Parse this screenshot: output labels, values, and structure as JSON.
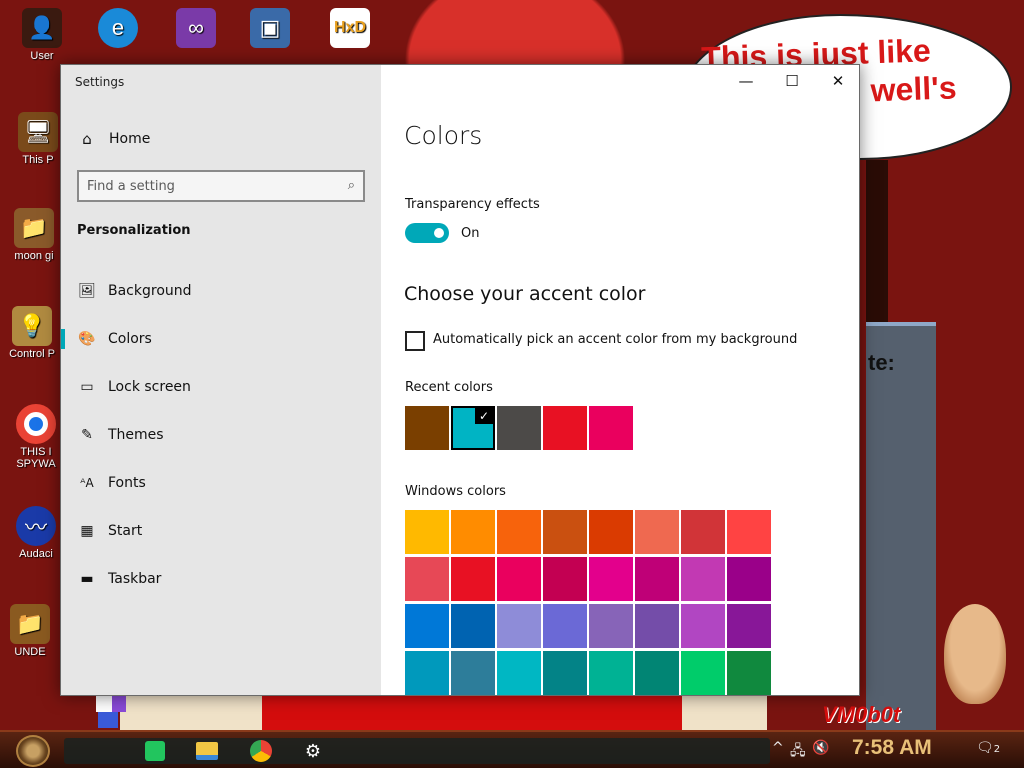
{
  "desktop": {
    "icons": [
      {
        "label": "User",
        "icon": "user-folder-icon",
        "color": "#5a1a0a"
      },
      {
        "label": "This P",
        "icon": "this-pc-icon",
        "color": "#7a4a1a"
      },
      {
        "label": "moon gi",
        "icon": "moon-folder-icon",
        "color": "#8a5a2a"
      },
      {
        "label": "Control P",
        "icon": "lightbulb-icon",
        "color": "#b08a40"
      },
      {
        "label": "THIS I",
        "icon": "chrome-icon",
        "color": "#1a73e8"
      },
      {
        "label": "SPYWA",
        "icon": "",
        "color": ""
      },
      {
        "label": "Audaci",
        "icon": "audacity-icon",
        "color": "#f08a1a"
      },
      {
        "label": "UNDE",
        "icon": "folder-icon",
        "color": "#8a5a20"
      }
    ],
    "top_icons": [
      {
        "label": "",
        "icon": "edge-icon",
        "color": "#1a8ad8"
      },
      {
        "label": "",
        "icon": "visual-studio-icon",
        "color": "#7a3aa8"
      },
      {
        "label": "",
        "icon": "virtualbox-icon",
        "color": "#3a6aa8"
      },
      {
        "label": "",
        "icon": "hxd-icon",
        "color": "#e8a020"
      }
    ],
    "speech_line1": "This is just like",
    "speech_line2": "well's",
    "gray_panel_text": "te:",
    "vm_text": "VM0b0t"
  },
  "window": {
    "title": "Settings",
    "controls": {
      "minimize": "—",
      "maximize": "☐",
      "close": "✕"
    }
  },
  "sidebar": {
    "home_label": "Home",
    "search_placeholder": "Find a setting",
    "section": "Personalization",
    "items": [
      {
        "label": "Background",
        "icon": "image-icon",
        "glyph": "🖼"
      },
      {
        "label": "Colors",
        "icon": "palette-icon",
        "glyph": "🎨",
        "active": true
      },
      {
        "label": "Lock screen",
        "icon": "lock-screen-icon",
        "glyph": "🖵"
      },
      {
        "label": "Themes",
        "icon": "brush-icon",
        "glyph": "✎"
      },
      {
        "label": "Fonts",
        "icon": "fonts-icon",
        "glyph": "A"
      },
      {
        "label": "Start",
        "icon": "start-tiles-icon",
        "glyph": "▦"
      },
      {
        "label": "Taskbar",
        "icon": "taskbar-icon",
        "glyph": "▭"
      }
    ]
  },
  "content": {
    "title": "Colors",
    "transparency_label": "Transparency effects",
    "transparency_state": "On",
    "accent_title": "Choose your accent color",
    "auto_pick_label": "Automatically pick an accent color from my background",
    "recent_label": "Recent colors",
    "recent_colors": [
      "#7a3f00",
      "#00b4c4",
      "#4c4a48",
      "#e81123",
      "#ea005e"
    ],
    "selected_recent": 1,
    "windows_label": "Windows colors",
    "windows_colors": [
      [
        "#ffb900",
        "#ff8c00",
        "#f7630c",
        "#ca5010",
        "#da3b01",
        "#ef6950",
        "#d13438",
        "#ff4343"
      ],
      [
        "#e74856",
        "#e81123",
        "#ea005e",
        "#c30052",
        "#e3008c",
        "#bf0077",
        "#c239b3",
        "#9a0089"
      ],
      [
        "#0078d7",
        "#0063b1",
        "#8e8cd8",
        "#6b69d6",
        "#8764b8",
        "#744da9",
        "#b146c2",
        "#881798"
      ],
      [
        "#0099bc",
        "#2d7d9a",
        "#00b7c3",
        "#038387",
        "#00b294",
        "#018574",
        "#00cc6a",
        "#10893e"
      ]
    ]
  },
  "taskbar": {
    "apps": [
      {
        "icon": "notes-icon",
        "color": "#22c55e"
      },
      {
        "icon": "file-explorer-icon",
        "color": "#f2c744"
      },
      {
        "icon": "chrome-icon",
        "color": "#ea4335"
      },
      {
        "icon": "settings-gear-icon",
        "color": "#ffffff"
      }
    ],
    "time": "7:58 AM",
    "notification_count": "2"
  }
}
